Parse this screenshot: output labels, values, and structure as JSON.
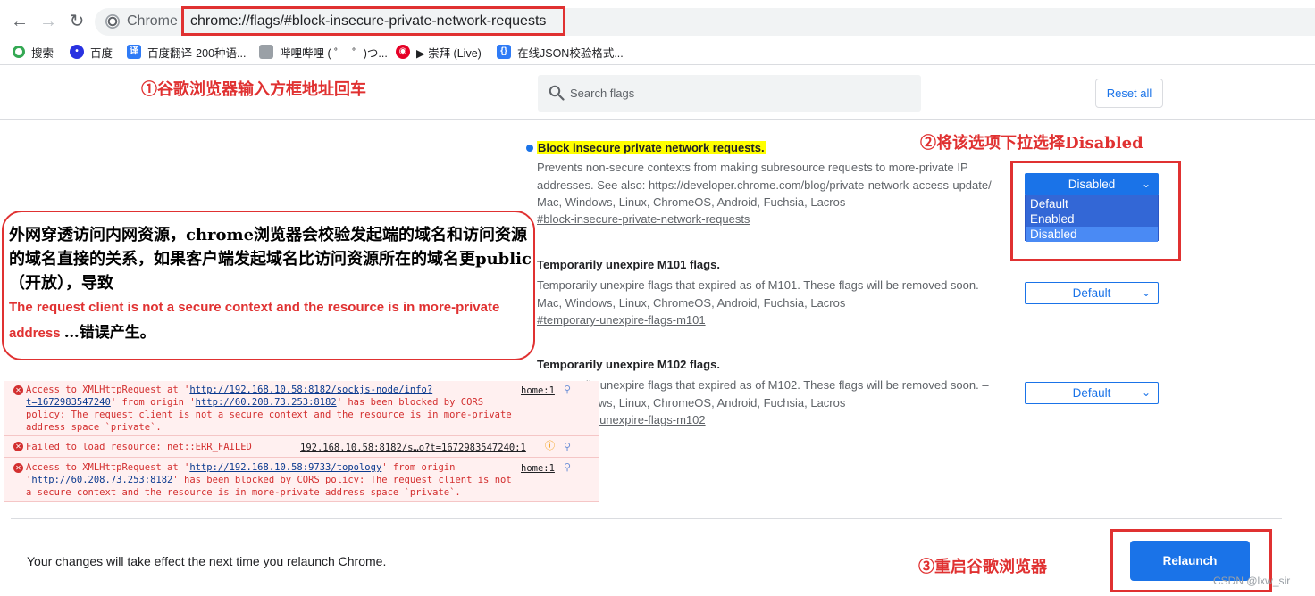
{
  "browser": {
    "chip_label": "Chrome",
    "url": "chrome://flags/#block-insecure-private-network-requests"
  },
  "bookmarks": [
    {
      "label": "搜索",
      "icon": "search-circle-icon",
      "color": "#34a853"
    },
    {
      "label": "百度",
      "icon": "baidu-paw-icon",
      "color": "#2932e1"
    },
    {
      "label": "百度翻译-200种语...",
      "icon": "baidu-translate-icon",
      "color": "#2f7bf6",
      "glyph": "译"
    },
    {
      "label": "哔哩哔哩 ( ゜- ゜)つ...",
      "icon": "bilibili-icon",
      "color": "#9aa0a6"
    },
    {
      "label": "▶ 崇拜 (Live)",
      "icon": "netease-music-icon",
      "color": "#e60026"
    },
    {
      "label": "在线JSON校验格式...",
      "icon": "json-tool-icon",
      "color": "#2f7bf6",
      "glyph": "{}"
    }
  ],
  "header": {
    "search_placeholder": "Search flags",
    "reset_label": "Reset all"
  },
  "flags": [
    {
      "title": "Block insecure private network requests.",
      "description": "Prevents non-secure contexts from making subresource requests to more-private IP addresses. See also: https://developer.chrome.com/blog/private-network-access-update/ – Mac, Windows, Linux, ChromeOS, Android, Fuchsia, Lacros",
      "link": "#block-insecure-private-network-requests",
      "selected": "Disabled",
      "options": [
        "Default",
        "Enabled",
        "Disabled"
      ]
    },
    {
      "title": "Temporarily unexpire M101 flags.",
      "description": "Temporarily unexpire flags that expired as of M101. These flags will be removed soon. – Mac, Windows, Linux, ChromeOS, Android, Fuchsia, Lacros",
      "link": "#temporary-unexpire-flags-m101",
      "selected": "Default"
    },
    {
      "title": "Temporarily unexpire M102 flags.",
      "description": "Temporarily unexpire flags that expired as of M102. These flags will be removed soon. – Mac, Windows, Linux, ChromeOS, Android, Fuchsia, Lacros",
      "link": "#temporary-unexpire-flags-m102",
      "selected": "Default"
    }
  ],
  "annotations": {
    "step1": "①谷歌浏览器输入方框地址回车",
    "step2": "②将该选项下拉选择Disabled",
    "step3": "③重启谷歌浏览器",
    "explain_cn": "外网穿透访问内网资源，chrome浏览器会校验发起端的域名和访问资源的域名直接的关系，如果客户端发起域名比访问资源所在的域名更public（开放），导致",
    "explain_en": "The request client is not a secure context and the resource is in more-private address",
    "explain_tail": "…错误产生。"
  },
  "console": {
    "errors": [
      {
        "prefix": "Access to XMLHttpRequest at '",
        "url1": "http://192.168.10.58:8182/sockjs-node/info?t=1672983547240",
        "mid": "' from origin '",
        "url2": "http://60.208.73.253:8182",
        "suffix": "' has been blocked by CORS policy: The request client is not a secure context and the resource is in more-private address space `private`.",
        "source": "home:1"
      },
      {
        "text": "Failed to load resource: net::ERR_FAILED",
        "source": "192.168.10.58:8182/s…o?t=1672983547240:1"
      },
      {
        "prefix": "Access to XMLHttpRequest at '",
        "url1": "http://192.168.10.58:9733/topology",
        "mid": "' from origin '",
        "url2": "http://60.208.73.253:8182",
        "suffix": "' has been blocked by CORS policy: The request client is not a secure context and the resource is in more-private address space `private`.",
        "source": "home:1"
      }
    ]
  },
  "footer": {
    "message": "Your changes will take effect the next time you relaunch Chrome.",
    "relaunch_label": "Relaunch",
    "watermark": "CSDN @lxw_sir"
  },
  "colors": {
    "accent": "#1a73e8",
    "annotation_red": "#e03131",
    "highlight_yellow": "#ffff00",
    "console_error": "#d32f2f"
  }
}
